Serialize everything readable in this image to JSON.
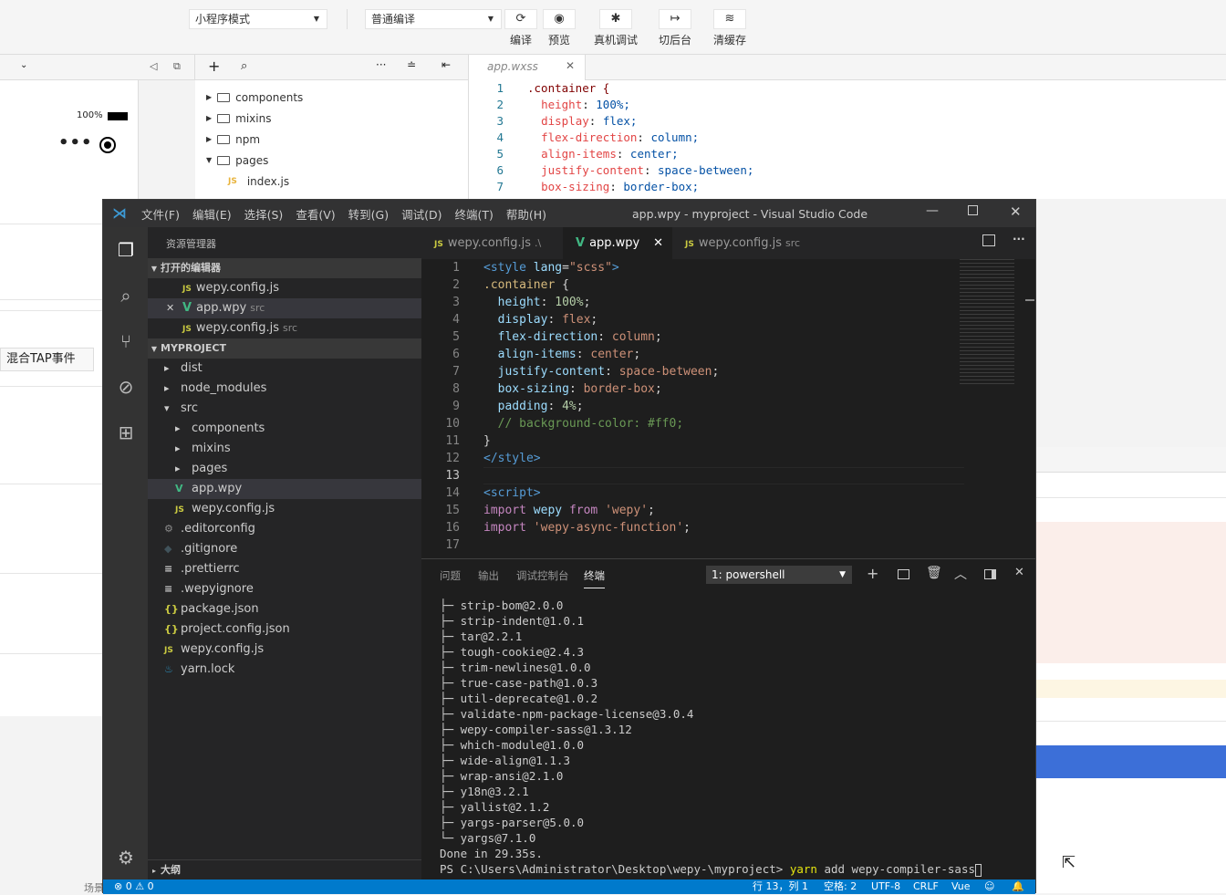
{
  "devtools": {
    "mode_select": "小程序模式",
    "compile_select": "普通编译",
    "buttons": [
      {
        "icon": "refresh-icon",
        "label": "编译"
      },
      {
        "icon": "eye-icon",
        "label": "预览"
      },
      {
        "icon": "bug-icon",
        "label": "真机调试"
      },
      {
        "icon": "switch-icon",
        "label": "切后台"
      },
      {
        "icon": "layers-icon",
        "label": "清缓存"
      }
    ],
    "battery": "100%",
    "tap_event_label": "混合TAP事件",
    "bottom_label": "场景",
    "tree": [
      {
        "label": "components",
        "expanded": false
      },
      {
        "label": "mixins",
        "expanded": false
      },
      {
        "label": "npm",
        "expanded": false
      },
      {
        "label": "pages",
        "expanded": true
      },
      {
        "label": "index.js",
        "file": true
      }
    ],
    "editor_tab": "app.wxss",
    "code": [
      {
        "n": "1",
        "text": ".container {"
      },
      {
        "n": "2",
        "prop": "height",
        "val": "100%;"
      },
      {
        "n": "3",
        "prop": "display",
        "val": "flex;"
      },
      {
        "n": "4",
        "prop": "flex-direction",
        "val": "column;"
      },
      {
        "n": "5",
        "prop": "align-items",
        "val": "center;"
      },
      {
        "n": "6",
        "prop": "justify-content",
        "val": "space-between;"
      },
      {
        "n": "7",
        "prop": "box-sizing",
        "val": "border-box;"
      }
    ]
  },
  "vscode": {
    "menu": [
      "文件(F)",
      "编辑(E)",
      "选择(S)",
      "查看(V)",
      "转到(G)",
      "调试(D)",
      "终端(T)",
      "帮助(H)"
    ],
    "title": "app.wpy - myproject - Visual Studio Code",
    "sidebar_title": "资源管理器",
    "open_editors_header": "打开的编辑器",
    "open_editors": [
      {
        "type": "js",
        "name": "wepy.config.js",
        "hint": ""
      },
      {
        "type": "vue",
        "name": "app.wpy",
        "hint": "src",
        "close": "✕"
      },
      {
        "type": "js",
        "name": "wepy.config.js",
        "hint": "src"
      }
    ],
    "project_header": "MYPROJECT",
    "tree": [
      {
        "name": "dist",
        "kind": "folder",
        "depth": 0
      },
      {
        "name": "node_modules",
        "kind": "folder",
        "depth": 0
      },
      {
        "name": "src",
        "kind": "folder-open",
        "depth": 0
      },
      {
        "name": "components",
        "kind": "folder",
        "depth": 1
      },
      {
        "name": "mixins",
        "kind": "folder",
        "depth": 1
      },
      {
        "name": "pages",
        "kind": "folder",
        "depth": 1
      },
      {
        "name": "app.wpy",
        "kind": "vue",
        "depth": 1
      },
      {
        "name": "wepy.config.js",
        "kind": "js",
        "depth": 1
      },
      {
        "name": ".editorconfig",
        "kind": "gear",
        "depth": 0
      },
      {
        "name": ".gitignore",
        "kind": "diamond",
        "depth": 0
      },
      {
        "name": ".prettierrc",
        "kind": "lines",
        "depth": 0
      },
      {
        "name": ".wepyignore",
        "kind": "lines",
        "depth": 0
      },
      {
        "name": "package.json",
        "kind": "json",
        "depth": 0
      },
      {
        "name": "project.config.json",
        "kind": "json",
        "depth": 0
      },
      {
        "name": "wepy.config.js",
        "kind": "js",
        "depth": 0
      },
      {
        "name": "yarn.lock",
        "kind": "yarn",
        "depth": 0
      }
    ],
    "outline_label": "大纲",
    "tabs": [
      {
        "type": "js",
        "name": "wepy.config.js",
        "hint": ".\\"
      },
      {
        "type": "vue",
        "name": "app.wpy",
        "hint": "",
        "active": true
      },
      {
        "type": "js",
        "name": "wepy.config.js",
        "hint": "src"
      }
    ],
    "code": [
      {
        "n": "1",
        "parts": [
          [
            "t-tag",
            "<style "
          ],
          [
            "t-att",
            "lang"
          ],
          [
            "t-txt",
            "="
          ],
          [
            "t-str",
            "\"scss\""
          ],
          [
            "t-tag",
            ">"
          ]
        ]
      },
      {
        "n": "2",
        "parts": [
          [
            "t-sel",
            ".container"
          ],
          [
            "t-txt",
            " {"
          ]
        ]
      },
      {
        "n": "3",
        "parts": [
          [
            "t-txt",
            "  "
          ],
          [
            "t-prop",
            "height"
          ],
          [
            "t-txt",
            ": "
          ],
          [
            "t-num",
            "100%"
          ],
          [
            "t-txt",
            ";"
          ]
        ]
      },
      {
        "n": "4",
        "parts": [
          [
            "t-txt",
            "  "
          ],
          [
            "t-prop",
            "display"
          ],
          [
            "t-txt",
            ": "
          ],
          [
            "t-str",
            "flex"
          ],
          [
            "t-txt",
            ";"
          ]
        ]
      },
      {
        "n": "5",
        "parts": [
          [
            "t-txt",
            "  "
          ],
          [
            "t-prop",
            "flex-direction"
          ],
          [
            "t-txt",
            ": "
          ],
          [
            "t-str",
            "column"
          ],
          [
            "t-txt",
            ";"
          ]
        ]
      },
      {
        "n": "6",
        "parts": [
          [
            "t-txt",
            "  "
          ],
          [
            "t-prop",
            "align-items"
          ],
          [
            "t-txt",
            ": "
          ],
          [
            "t-str",
            "center"
          ],
          [
            "t-txt",
            ";"
          ]
        ]
      },
      {
        "n": "7",
        "parts": [
          [
            "t-txt",
            "  "
          ],
          [
            "t-prop",
            "justify-content"
          ],
          [
            "t-txt",
            ": "
          ],
          [
            "t-str",
            "space-between"
          ],
          [
            "t-txt",
            ";"
          ]
        ]
      },
      {
        "n": "8",
        "parts": [
          [
            "t-txt",
            "  "
          ],
          [
            "t-prop",
            "box-sizing"
          ],
          [
            "t-txt",
            ": "
          ],
          [
            "t-str",
            "border-box"
          ],
          [
            "t-txt",
            ";"
          ]
        ]
      },
      {
        "n": "9",
        "parts": [
          [
            "t-txt",
            "  "
          ],
          [
            "t-prop",
            "padding"
          ],
          [
            "t-txt",
            ": "
          ],
          [
            "t-num",
            "4%"
          ],
          [
            "t-txt",
            ";"
          ]
        ]
      },
      {
        "n": "10",
        "parts": [
          [
            "t-cmt",
            "  // background-color: #ff0;"
          ]
        ]
      },
      {
        "n": "11",
        "parts": [
          [
            "t-txt",
            "}"
          ]
        ]
      },
      {
        "n": "12",
        "parts": [
          [
            "t-tag",
            "</style>"
          ]
        ]
      },
      {
        "n": "13",
        "parts": [
          [
            "t-txt",
            ""
          ]
        ]
      },
      {
        "n": "14",
        "parts": [
          [
            "t-tag",
            "<script>"
          ]
        ]
      },
      {
        "n": "15",
        "parts": [
          [
            "t-kw",
            "import "
          ],
          [
            "t-att",
            "wepy "
          ],
          [
            "t-kw",
            "from "
          ],
          [
            "t-str",
            "'wepy'"
          ],
          [
            "t-txt",
            ";"
          ]
        ]
      },
      {
        "n": "16",
        "parts": [
          [
            "t-kw",
            "import "
          ],
          [
            "t-str",
            "'wepy-async-function'"
          ],
          [
            "t-txt",
            ";"
          ]
        ]
      },
      {
        "n": "17",
        "parts": [
          [
            "t-txt",
            ""
          ]
        ]
      }
    ],
    "panel_tabs": [
      "问题",
      "输出",
      "调试控制台",
      "终端"
    ],
    "terminal_select": "1: powershell",
    "terminal": [
      "├─ strip-bom@2.0.0",
      "├─ strip-indent@1.0.1",
      "├─ tar@2.2.1",
      "├─ tough-cookie@2.4.3",
      "├─ trim-newlines@1.0.0",
      "├─ true-case-path@1.0.3",
      "├─ util-deprecate@1.0.2",
      "├─ validate-npm-package-license@3.0.4",
      "├─ wepy-compiler-sass@1.3.12",
      "├─ which-module@1.0.0",
      "├─ wide-align@1.1.3",
      "├─ wrap-ansi@2.1.0",
      "├─ y18n@3.2.1",
      "├─ yallist@2.1.2",
      "├─ yargs-parser@5.0.0",
      "└─ yargs@7.1.0",
      "Done in 29.35s."
    ],
    "prompt": "PS C:\\Users\\Administrator\\Desktop\\wepy-\\myproject> ",
    "command_bin": "yarn",
    "command_args": " add wepy-compiler-sass",
    "status": {
      "errors": "0",
      "warnings": "0",
      "position": "行 13，列 1",
      "indent": "空格: 2",
      "encoding": "UTF-8",
      "eol": "CRLF",
      "language": "Vue"
    }
  }
}
